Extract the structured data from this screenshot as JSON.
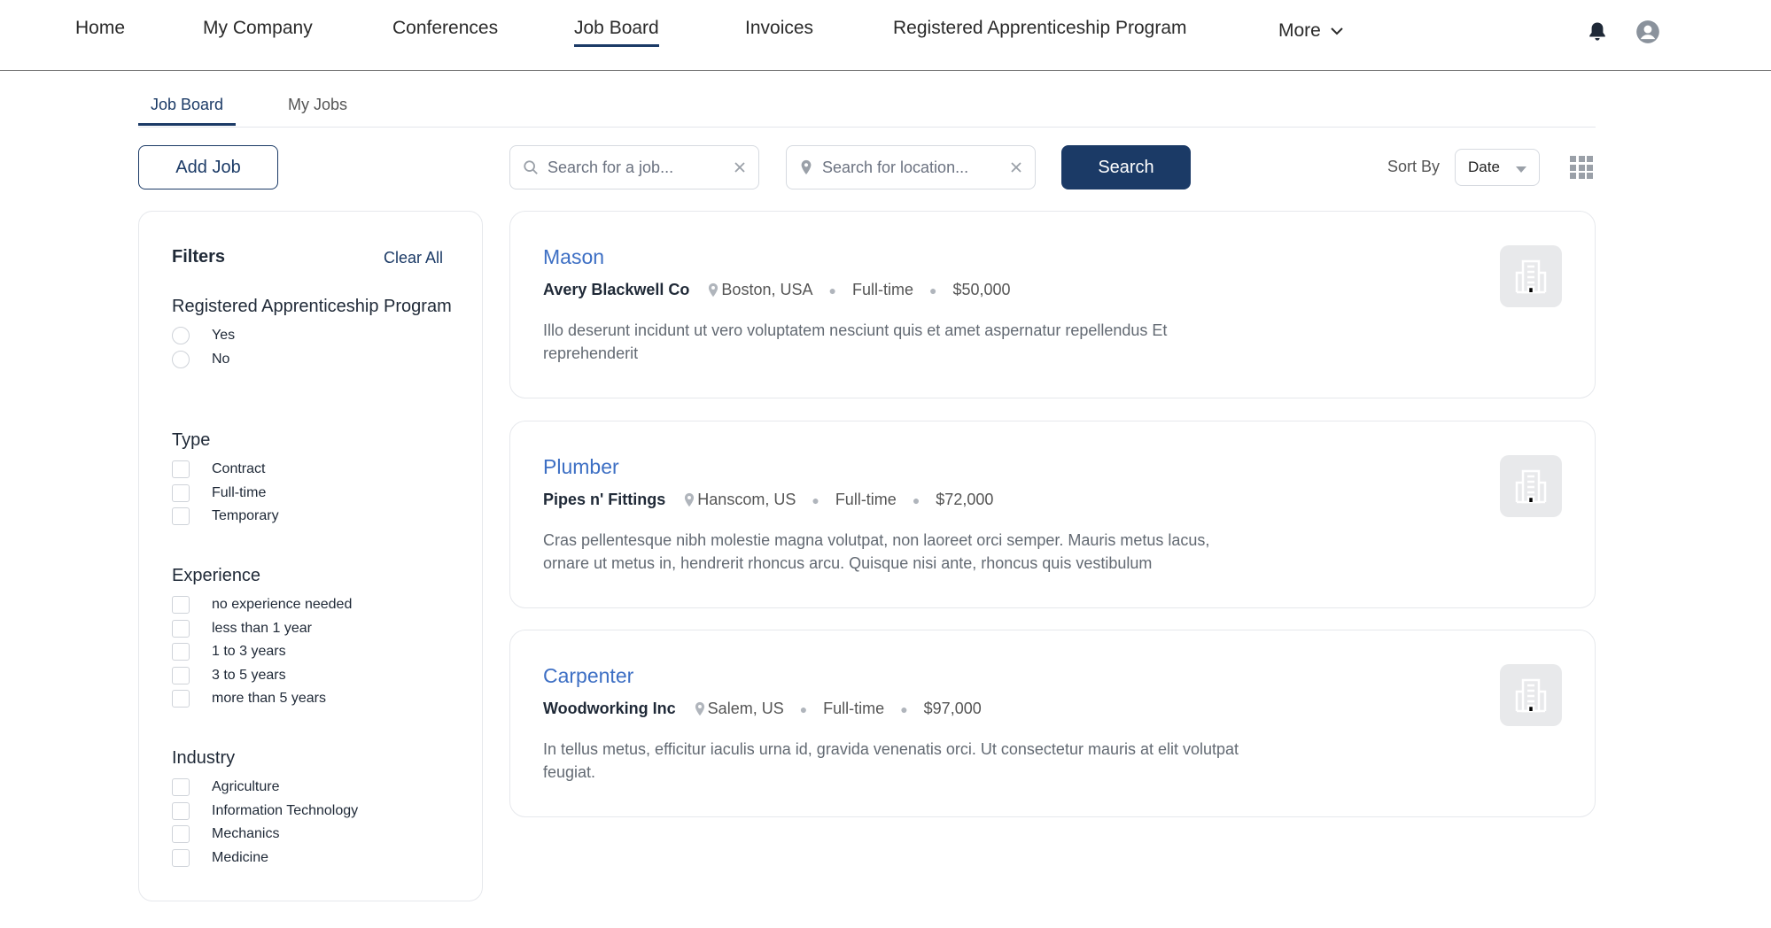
{
  "nav": {
    "items": [
      "Home",
      "My Company",
      "Conferences",
      "Job Board",
      "Invoices",
      "Registered Apprenticeship Program"
    ],
    "more_label": "More",
    "active": "Job Board"
  },
  "subtabs": [
    "Job Board",
    "My Jobs"
  ],
  "toolbar": {
    "add_job_label": "Add Job",
    "job_search_placeholder": "Search for a job...",
    "location_search_placeholder": "Search for location...",
    "search_label": "Search",
    "sort_by_label": "Sort By",
    "sort_value": "Date"
  },
  "filters": {
    "title": "Filters",
    "clear_all": "Clear All",
    "groups": [
      {
        "title": "Registered Apprenticeship Program",
        "type": "radio",
        "options": [
          "Yes",
          "No"
        ]
      },
      {
        "title": "Type",
        "type": "checkbox",
        "options": [
          "Contract",
          "Full-time",
          "Temporary"
        ]
      },
      {
        "title": "Experience",
        "type": "checkbox",
        "options": [
          "no experience needed",
          "less than 1 year",
          "1 to 3 years",
          "3 to 5 years",
          "more than 5 years"
        ]
      },
      {
        "title": "Industry",
        "type": "checkbox",
        "options": [
          "Agriculture",
          "Information Technology",
          "Mechanics",
          "Medicine"
        ]
      }
    ]
  },
  "jobs": [
    {
      "title": "Mason",
      "company": "Avery Blackwell Co",
      "location": "Boston, USA",
      "type": "Full-time",
      "salary": "$50,000",
      "description": "Illo deserunt incidunt ut vero voluptatem nesciunt quis et amet aspernatur repellendus Et reprehenderit"
    },
    {
      "title": "Plumber",
      "company": "Pipes n' Fittings",
      "location": "Hanscom, US",
      "type": "Full-time",
      "salary": "$72,000",
      "description": "Cras pellentesque nibh molestie magna volutpat, non laoreet orci semper. Mauris metus lacus, ornare ut metus in, hendrerit rhoncus arcu. Quisque nisi ante, rhoncus quis vestibulum"
    },
    {
      "title": "Carpenter",
      "company": "Woodworking Inc",
      "location": "Salem, US",
      "type": "Full-time",
      "salary": "$97,000",
      "description": "In tellus metus, efficitur iaculis urna id, gravida venenatis orci. Ut consectetur mauris at elit volutpat feugiat."
    }
  ],
  "colors": {
    "primary": "#1b3a66",
    "link": "#3d6fc4",
    "border": "#e6e8ec"
  },
  "icons": [
    "bell-icon",
    "user-avatar-icon",
    "chevron-down-icon",
    "search-icon",
    "location-pin-icon",
    "clear-x-icon",
    "grid-view-icon",
    "building-icon"
  ]
}
